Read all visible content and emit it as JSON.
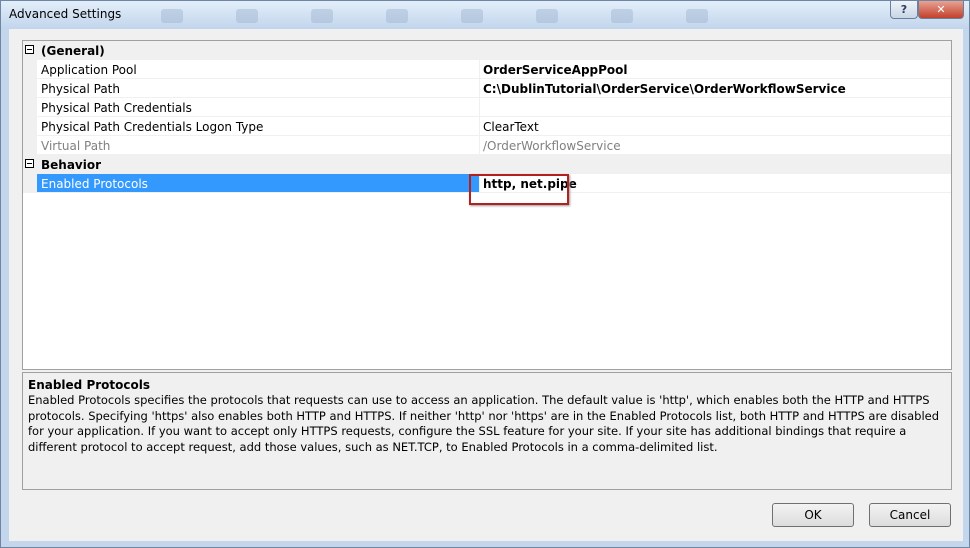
{
  "window": {
    "title": "Advanced Settings",
    "help_label": "?",
    "close_label": "✕"
  },
  "grid": {
    "categories": [
      {
        "label": "(General)",
        "properties": [
          {
            "name": "Application Pool",
            "value": "OrderServiceAppPool"
          },
          {
            "name": "Physical Path",
            "value": "C:\\DublinTutorial\\OrderService\\OrderWorkflowService"
          },
          {
            "name": "Physical Path Credentials",
            "value": ""
          },
          {
            "name": "Physical Path Credentials Logon Type",
            "value": "ClearText"
          },
          {
            "name": "Virtual Path",
            "value": "/OrderWorkflowService"
          }
        ]
      },
      {
        "label": "Behavior",
        "properties": [
          {
            "name": "Enabled Protocols",
            "value": "http, net.pipe"
          }
        ]
      }
    ]
  },
  "description": {
    "title": "Enabled Protocols",
    "text": "Enabled Protocols specifies the protocols that requests can use to access an application. The default value is 'http', which enables both the HTTP and HTTPS protocols. Specifying 'https' also enables both HTTP and HTTPS. If neither 'http' nor 'https' are in the Enabled Protocols list, both HTTP and HTTPS are disabled for your application. If you want to accept only HTTPS requests, configure the SSL feature for your site. If your site has additional bindings that require a different protocol to accept request, add those values, such as NET.TCP, to Enabled Protocols in a comma-delimited list."
  },
  "buttons": {
    "ok_label": "OK",
    "cancel_label": "Cancel"
  }
}
